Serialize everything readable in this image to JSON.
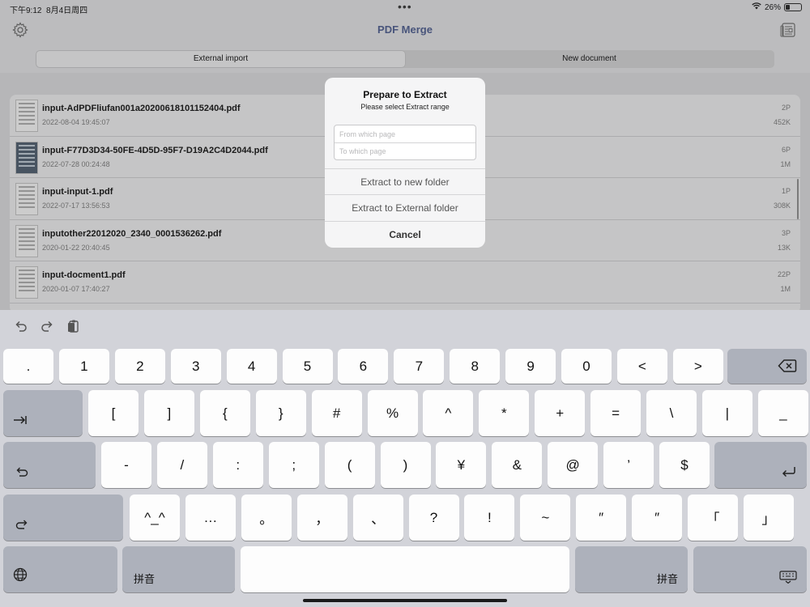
{
  "status_bar": {
    "time": "下午9:12",
    "date": "8月4日周四",
    "battery": "26%",
    "battery_level": 0.26
  },
  "nav": {
    "title": "PDF Merge"
  },
  "segments": [
    {
      "label": "External import",
      "active": true
    },
    {
      "label": "New document",
      "active": false
    }
  ],
  "files": [
    {
      "name": "input-AdPDFliufan001a20200618101152404.pdf",
      "date": "2022-08-04 19:45:07",
      "pages": "2P",
      "size": "452K"
    },
    {
      "name": "input-F77D3D34-50FE-4D5D-95F7-D19A2C4D2044.pdf",
      "date": "2022-07-28 00:24:48",
      "pages": "6P",
      "size": "1M"
    },
    {
      "name": "input-input-1.pdf",
      "date": "2022-07-17 13:56:53",
      "pages": "1P",
      "size": "308K"
    },
    {
      "name": "inputother22012020_2340_0001536262.pdf",
      "date": "2020-01-22 20:40:45",
      "pages": "3P",
      "size": "13K"
    },
    {
      "name": "input-docment1.pdf",
      "date": "2020-01-07 17:40:27",
      "pages": "22P",
      "size": "1M"
    }
  ],
  "alert": {
    "title": "Prepare to Extract",
    "message": "Please select Extract range",
    "from_placeholder": "From which page",
    "to_placeholder": "To which page",
    "btn_new_folder": "Extract to new folder",
    "btn_external": "Extract to External folder",
    "btn_cancel": "Cancel"
  },
  "keyboard": {
    "row1": [
      ".",
      "1",
      "2",
      "3",
      "4",
      "5",
      "6",
      "7",
      "8",
      "9",
      "0",
      "<",
      ">"
    ],
    "row2": [
      "[",
      "]",
      "{",
      "}",
      "#",
      "%",
      "^",
      "*",
      "+",
      "=",
      "\\",
      "|",
      "_"
    ],
    "row3": [
      "-",
      "/",
      ":",
      ";",
      "(",
      ")",
      "¥",
      "&",
      "@",
      "’",
      "$"
    ],
    "row4": [
      "^_^",
      "…",
      "。",
      "，",
      "、",
      "?",
      "!",
      "~",
      "″",
      "″",
      "「",
      "」"
    ],
    "pinyin_label": "拼音"
  }
}
